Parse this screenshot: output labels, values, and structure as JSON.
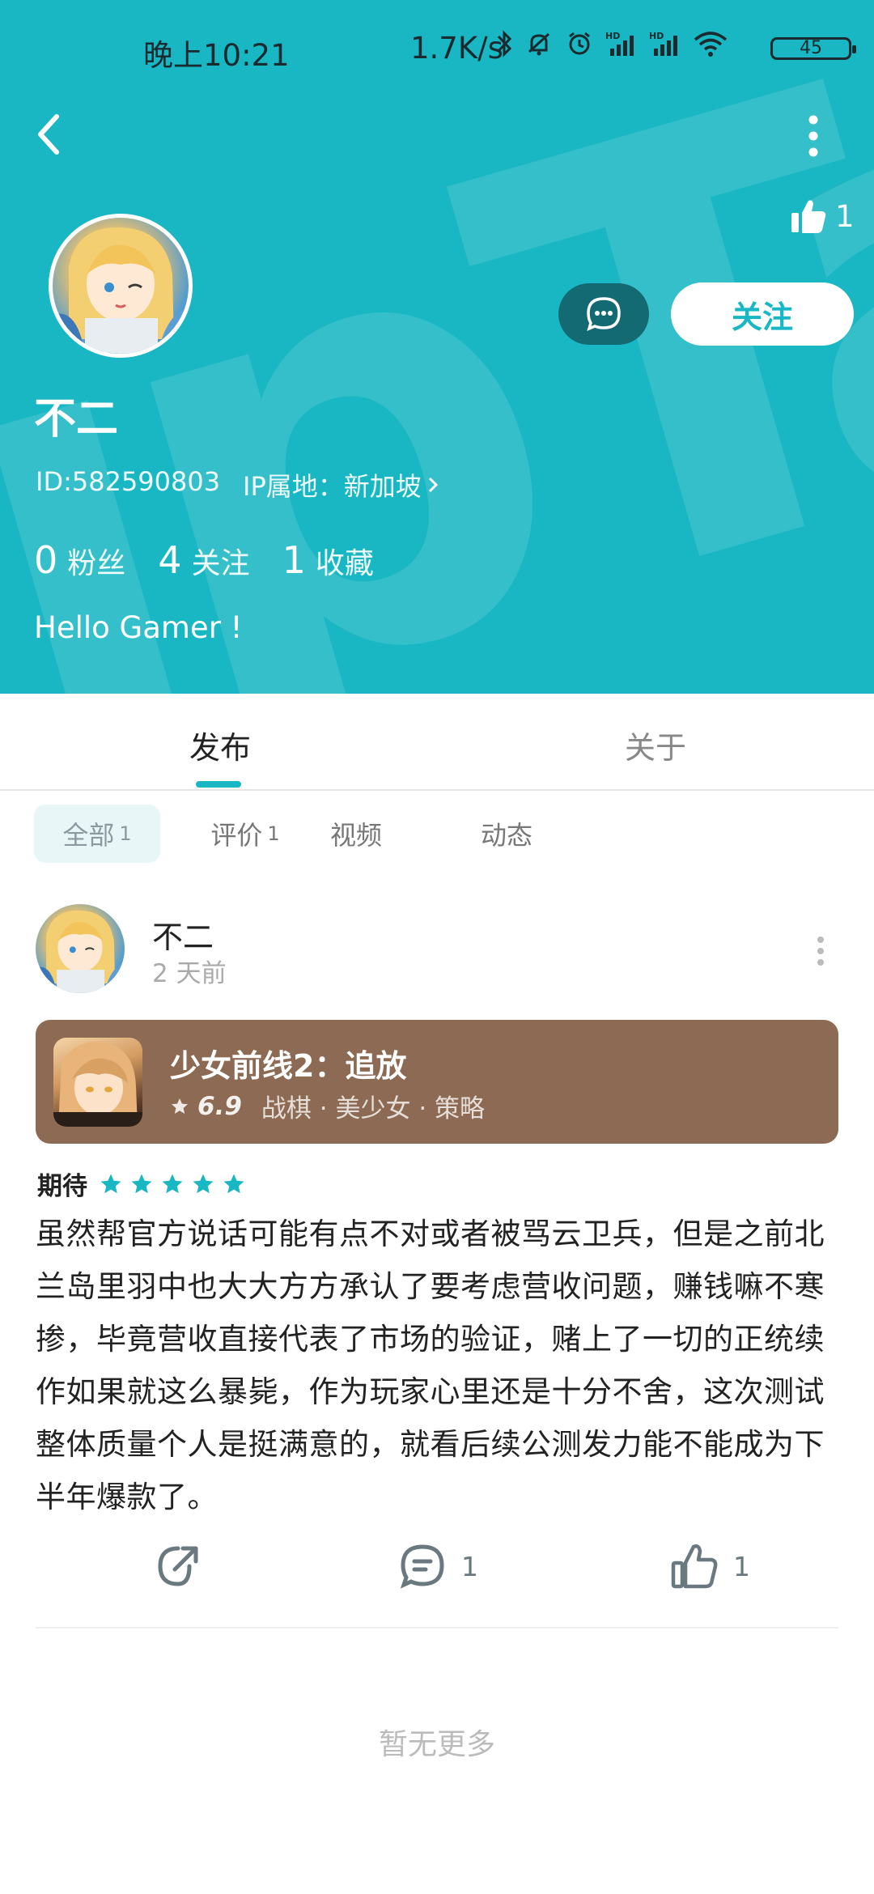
{
  "status_bar": {
    "time": "晚上10:21",
    "speed": "1.7K/s",
    "battery": "45"
  },
  "profile": {
    "username": "不二",
    "id_text": "ID:582590803",
    "ip_text": "IP属地：新加坡",
    "likes": "1",
    "follow_label": "关注",
    "stats": [
      {
        "num": "0",
        "label": "粉丝"
      },
      {
        "num": "4",
        "label": "关注"
      },
      {
        "num": "1",
        "label": "收藏"
      }
    ],
    "bio": "Hello Gamer !"
  },
  "tabs": {
    "items": [
      {
        "label": "发布"
      },
      {
        "label": "关于"
      }
    ]
  },
  "filters": [
    {
      "label": "全部",
      "count": "1"
    },
    {
      "label": "评价",
      "count": "1"
    },
    {
      "label": "视频",
      "count": ""
    },
    {
      "label": "动态",
      "count": ""
    }
  ],
  "post": {
    "author": "不二",
    "time": "2 天前",
    "game": {
      "title": "少女前线2：追放",
      "rating": "6.9",
      "tags": "战棋 · 美少女 · 策略"
    },
    "expect_label": "期待",
    "star_count": 5,
    "body": "虽然帮官方说话可能有点不对或者被骂云卫兵，但是之前北兰岛里羽中也大大方方承认了要考虑营收问题，赚钱嘛不寒掺，毕竟营收直接代表了市场的验证，赌上了一切的正统续作如果就这么暴毙，作为玩家心里还是十分不舍，这次测试整体质量个人是挺满意的，就看后续公测发力能不能成为下半年爆款了。",
    "comment_count": "1",
    "like_count": "1"
  },
  "footer": {
    "no_more": "暂无更多"
  },
  "colors": {
    "accent": "#18b7c3",
    "card_bg": "#8c6a53"
  }
}
